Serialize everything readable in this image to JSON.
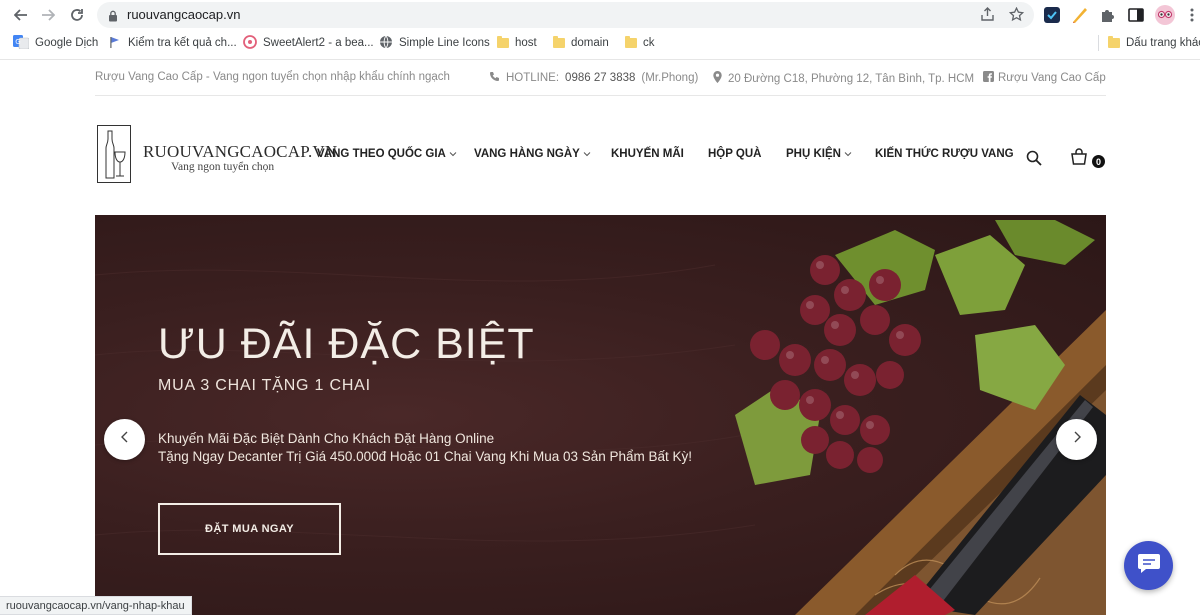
{
  "browser": {
    "url": "ruouvangcaocap.vn",
    "bookmarks": [
      {
        "label": "Google Dịch"
      },
      {
        "label": "Kiểm tra kết quả ch..."
      },
      {
        "label": "SweetAlert2 - a bea..."
      },
      {
        "label": "Simple Line Icons"
      },
      {
        "label": "host"
      },
      {
        "label": "domain"
      },
      {
        "label": "ck"
      },
      {
        "label": "Dấu trang khác"
      }
    ],
    "status_url": "ruouvangcaocap.vn/vang-nhap-khau"
  },
  "topbar": {
    "tagline": "Rượu Vang Cao Cấp - Vang ngon tuyển chọn nhập khẩu chính ngạch",
    "hotline_label": "HOTLINE:",
    "hotline_number": "0986 27 3838",
    "hotline_name": "(Mr.Phong)",
    "address": "20 Đường C18, Phường 12, Tân Bình, Tp. HCM",
    "facebook": "Rượu Vang Cao Cấp"
  },
  "header": {
    "logo_title": "RUOUVANGCAOCAP.VN",
    "logo_subtitle": "Vang ngon tuyển chọn",
    "menu": [
      {
        "label": "VANG THEO QUỐC GIA",
        "dropdown": true
      },
      {
        "label": "VANG HÀNG NGÀY",
        "dropdown": true
      },
      {
        "label": "KHUYẾN MÃI",
        "dropdown": false
      },
      {
        "label": "HỘP QUÀ",
        "dropdown": false
      },
      {
        "label": "PHỤ KIỆN",
        "dropdown": true
      },
      {
        "label": "KIẾN THỨC RƯỢU VANG",
        "dropdown": false
      }
    ],
    "cart_count": "0"
  },
  "hero": {
    "title": "ƯU ĐÃI ĐẶC BIỆT",
    "subtitle": "MUA 3 CHAI TẶNG 1 CHAI",
    "line1": "Khuyến Mãi Đặc Biệt Dành Cho Khách Đặt Hàng Online",
    "line2": "Tặng Ngay Decanter Trị Giá 450.000đ Hoặc 01 Chai Vang Khi Mua 03 Sản Phẩm Bất Kỳ!",
    "cta": "ĐẶT MUA NGAY"
  },
  "colors": {
    "hero_bg": "#3a1f1f",
    "chat": "#3f51c9",
    "grape": "#7a2230",
    "leaf": "#6f8f2e"
  }
}
